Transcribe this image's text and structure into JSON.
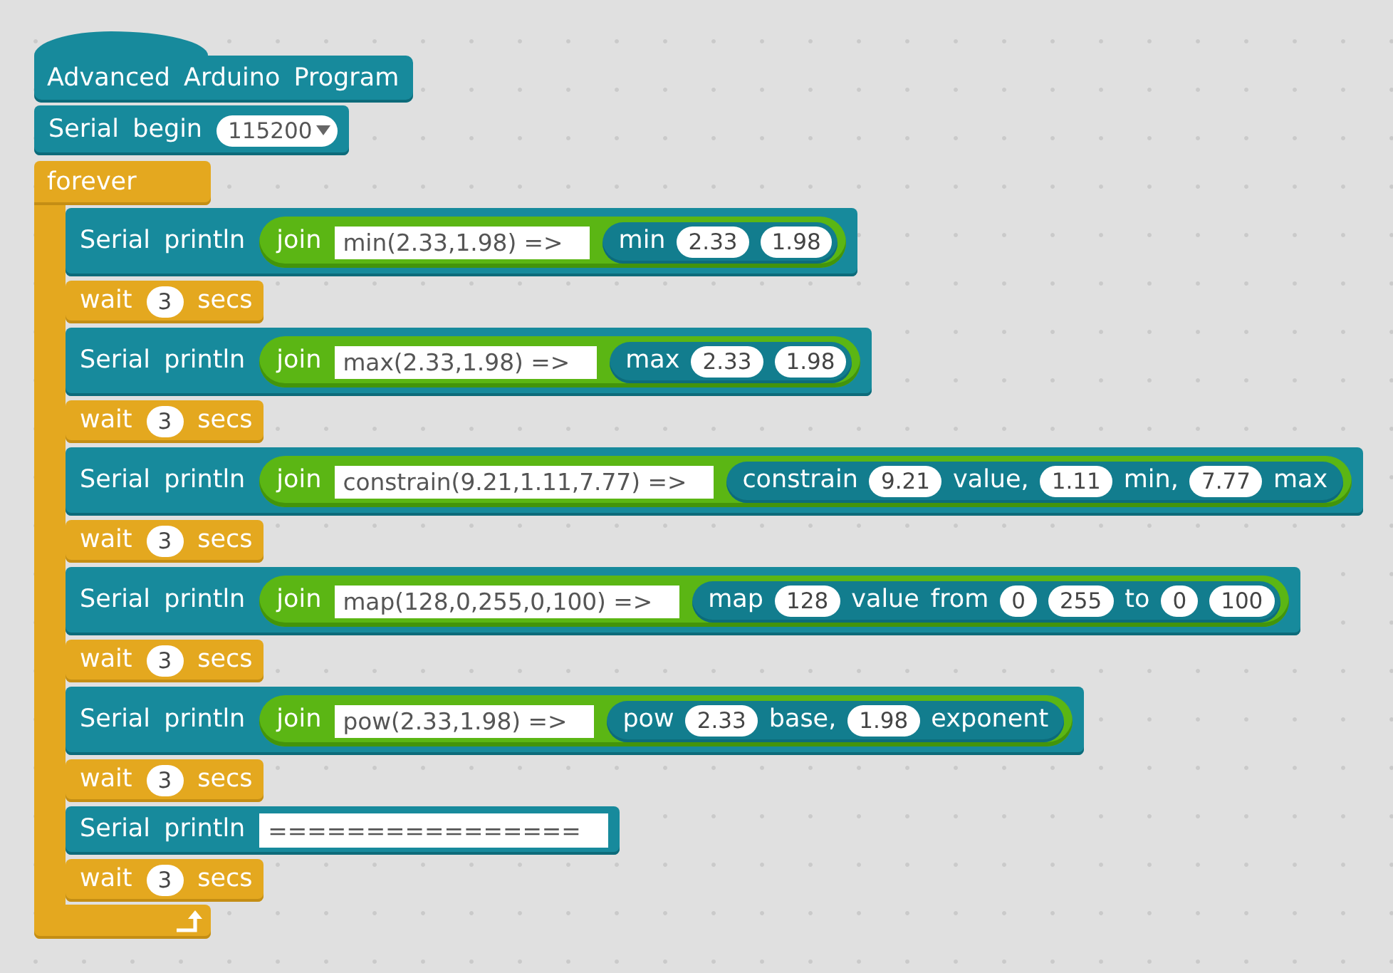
{
  "script": {
    "hat": {
      "label": "Advanced Arduino Program"
    },
    "setup": {
      "label": "Serial begin",
      "value": "115200"
    },
    "loop": {
      "label": "forever",
      "blocks": [
        {
          "kind": "println",
          "label": "Serial println",
          "input": {
            "kind": "join",
            "label": "join",
            "text": "min(2.33,1.98) =>",
            "reporter": [
              {
                "kind": "word",
                "text": "min"
              },
              {
                "kind": "number",
                "text": "2.33"
              },
              {
                "kind": "number",
                "text": "1.98"
              }
            ]
          }
        },
        {
          "kind": "wait",
          "label": "wait",
          "value": "3",
          "unit": "secs"
        },
        {
          "kind": "println",
          "label": "Serial println",
          "input": {
            "kind": "join",
            "label": "join",
            "text": "max(2.33,1.98) =>",
            "reporter": [
              {
                "kind": "word",
                "text": "max"
              },
              {
                "kind": "number",
                "text": "2.33"
              },
              {
                "kind": "number",
                "text": "1.98"
              }
            ]
          }
        },
        {
          "kind": "wait",
          "label": "wait",
          "value": "3",
          "unit": "secs"
        },
        {
          "kind": "println",
          "label": "Serial println",
          "input": {
            "kind": "join",
            "label": "join",
            "text": "constrain(9.21,1.11,7.77) =>",
            "reporter": [
              {
                "kind": "word",
                "text": "constrain"
              },
              {
                "kind": "number",
                "text": "9.21"
              },
              {
                "kind": "word",
                "text": "value,"
              },
              {
                "kind": "number",
                "text": "1.11"
              },
              {
                "kind": "word",
                "text": "min,"
              },
              {
                "kind": "number",
                "text": "7.77"
              },
              {
                "kind": "word",
                "text": "max"
              }
            ]
          }
        },
        {
          "kind": "wait",
          "label": "wait",
          "value": "3",
          "unit": "secs"
        },
        {
          "kind": "println",
          "label": "Serial println",
          "input": {
            "kind": "join",
            "label": "join",
            "text": "map(128,0,255,0,100) =>",
            "reporter": [
              {
                "kind": "word",
                "text": "map"
              },
              {
                "kind": "number",
                "text": "128"
              },
              {
                "kind": "word",
                "text": "value"
              },
              {
                "kind": "word",
                "text": "from"
              },
              {
                "kind": "number",
                "text": "0"
              },
              {
                "kind": "number",
                "text": "255"
              },
              {
                "kind": "word",
                "text": "to"
              },
              {
                "kind": "number",
                "text": "0"
              },
              {
                "kind": "number",
                "text": "100"
              }
            ]
          }
        },
        {
          "kind": "wait",
          "label": "wait",
          "value": "3",
          "unit": "secs"
        },
        {
          "kind": "println",
          "label": "Serial println",
          "input": {
            "kind": "join",
            "label": "join",
            "text": "pow(2.33,1.98) =>",
            "reporter": [
              {
                "kind": "word",
                "text": "pow"
              },
              {
                "kind": "number",
                "text": "2.33"
              },
              {
                "kind": "word",
                "text": "base,"
              },
              {
                "kind": "number",
                "text": "1.98"
              },
              {
                "kind": "word",
                "text": "exponent"
              }
            ]
          }
        },
        {
          "kind": "wait",
          "label": "wait",
          "value": "3",
          "unit": "secs"
        },
        {
          "kind": "println",
          "label": "Serial println",
          "input": {
            "kind": "text",
            "text": "================"
          }
        },
        {
          "kind": "wait",
          "label": "wait",
          "value": "3",
          "unit": "secs"
        }
      ]
    }
  }
}
